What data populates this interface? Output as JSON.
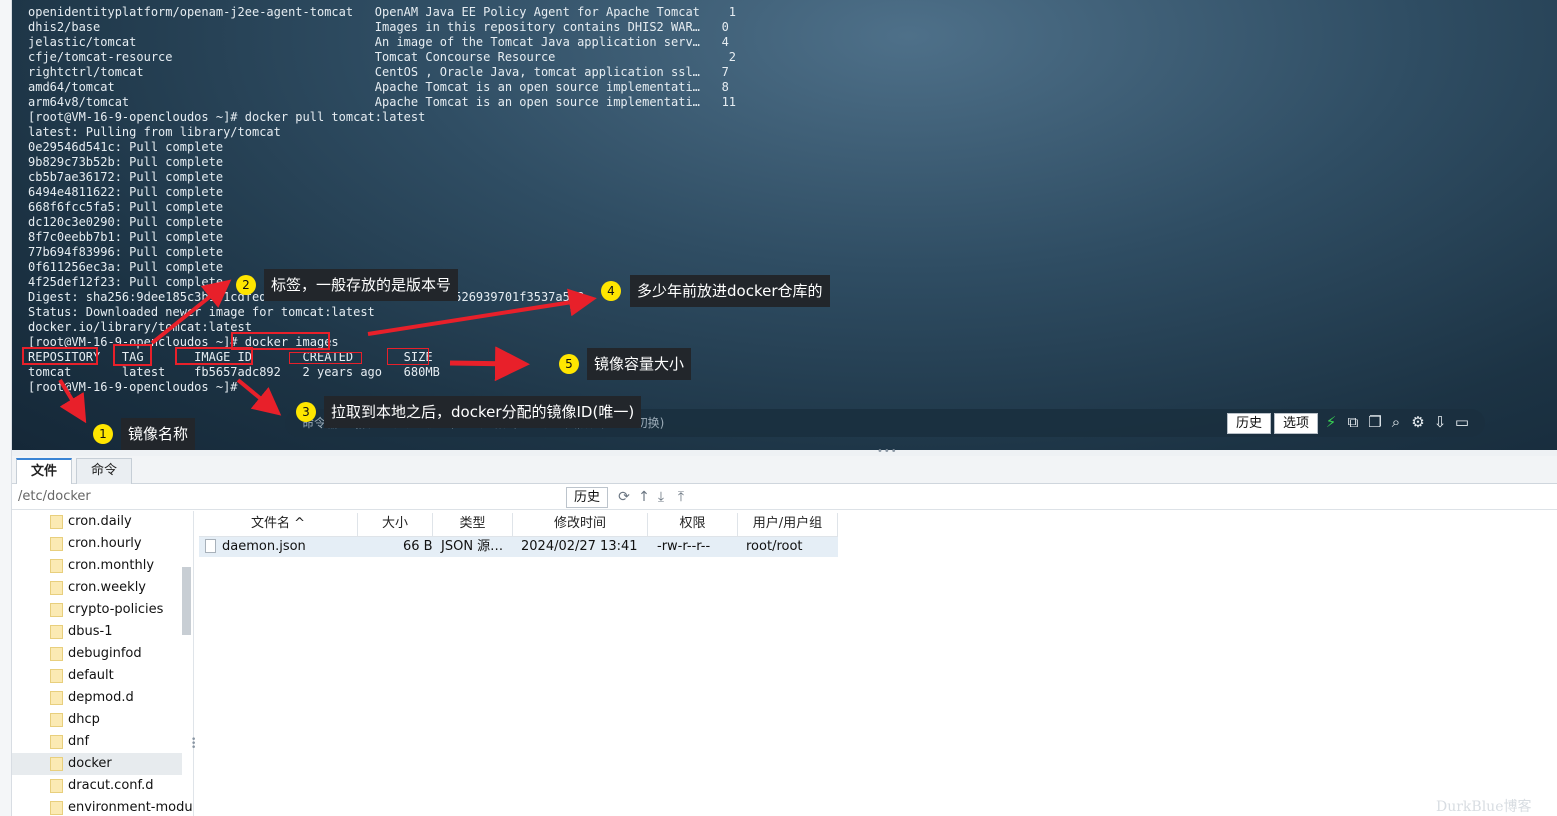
{
  "terminal": {
    "lines": [
      "openidentityplatform/openam-j2ee-agent-tomcat   OpenAM Java EE Policy Agent for Apache Tomcat    1",
      "dhis2/base                                      Images in this repository contains DHIS2 WAR…   0",
      "jelastic/tomcat                                 An image of the Tomcat Java application serv…   4",
      "cfje/tomcat-resource                            Tomcat Concourse Resource                        2",
      "rightctrl/tomcat                                CentOS , Oracle Java, tomcat application ssl…   7",
      "amd64/tomcat                                    Apache Tomcat is an open source implementati…   8",
      "arm64v8/tomcat                                  Apache Tomcat is an open source implementati…   11",
      "[root@VM-16-9-opencloudos ~]# docker pull tomcat:latest",
      "latest: Pulling from library/tomcat",
      "0e29546d541c: Pull complete",
      "9b829c73b52b: Pull complete",
      "cb5b7ae36172: Pull complete",
      "6494e4811622: Pull complete",
      "668f6fcc5fa5: Pull complete",
      "dc120c3e0290: Pull complete",
      "8f7c0eebb7b1: Pull complete",
      "77b694f83996: Pull complete",
      "0f611256ec3a: Pull complete",
      "4f25def12f23: Pull complete",
      "Digest: sha256:9dee185c3b161cdfede1f5e35e8b56ebc9de88ed3a79526939701f3537a523",
      "Status: Downloaded newer image for tomcat:latest",
      "docker.io/library/tomcat:latest",
      "[root@VM-16-9-opencloudos ~]# docker images",
      "REPOSITORY   TAG       IMAGE ID       CREATED       SIZE",
      "tomcat       latest    fb5657adc892   2 years ago   680MB",
      "[root@VM-16-9-opencloudos ~]#"
    ],
    "input_placeholder": "命令输入 (按ALT键提示历史,TAB键路径,ESC键返回,双击CTRL切换)",
    "history_button": "历史",
    "options_button": "选项"
  },
  "tabs": [
    "文件",
    "命令"
  ],
  "path": {
    "current": "/etc/docker",
    "history_button": "历史"
  },
  "tree": {
    "items": [
      "cron.daily",
      "cron.hourly",
      "cron.monthly",
      "cron.weekly",
      "crypto-policies",
      "dbus-1",
      "debuginfod",
      "default",
      "depmod.d",
      "dhcp",
      "dnf",
      "docker",
      "dracut.conf.d",
      "environment-modu"
    ],
    "selected": "docker"
  },
  "files": {
    "columns": [
      "文件名 ^",
      "大小",
      "类型",
      "修改时间",
      "权限",
      "用户/用户组"
    ],
    "rows": [
      {
        "name": "daemon.json",
        "size": "66 B",
        "type": "JSON 源…",
        "modified": "2024/02/27 13:41",
        "perms": "-rw-r--r--",
        "owner": "root/root"
      }
    ]
  },
  "annotations": [
    {
      "num": "1",
      "text": "镜像名称"
    },
    {
      "num": "2",
      "text": "标签，一般存放的是版本号"
    },
    {
      "num": "3",
      "text": "拉取到本地之后，docker分配的镜像ID(唯一)"
    },
    {
      "num": "4",
      "text": "多少年前放进docker仓库的"
    },
    {
      "num": "5",
      "text": "镜像容量大小"
    }
  ],
  "watermark": "DurkBlue博客",
  "colors": {
    "annotation_red": "#e8202a",
    "badge_yellow": "#ffe600",
    "callout_bg": "#22262b",
    "tab_accent": "#3a84d4"
  }
}
